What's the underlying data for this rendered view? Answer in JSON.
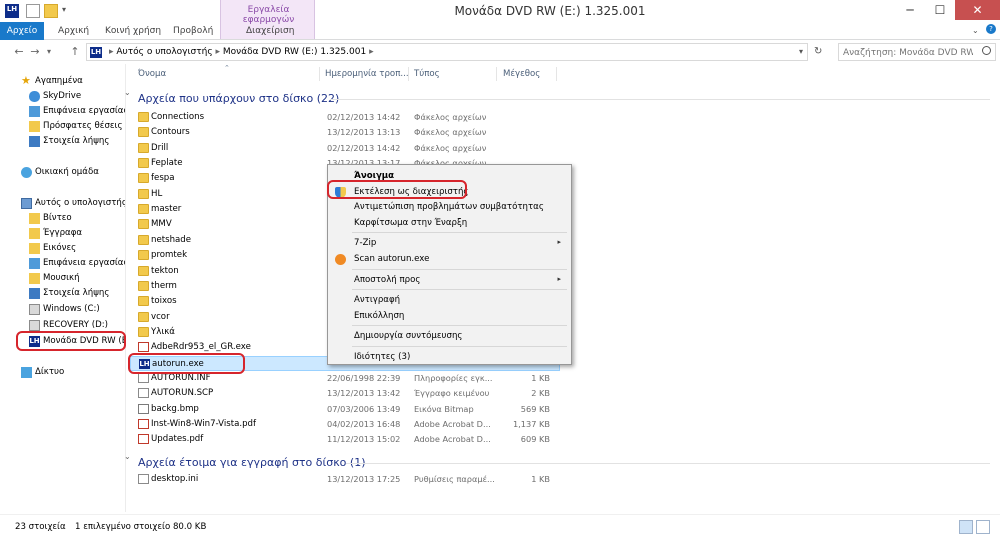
{
  "window": {
    "title": "Μονάδα DVD RW (E:) 1.325.001",
    "contextual_tab_group": "Εργαλεία εφαρμογών",
    "controls": {
      "minimize": "─",
      "maximize": "☐",
      "close": "✕"
    }
  },
  "ribbon": {
    "tabs": [
      "Αρχείο",
      "Αρχική",
      "Κοινή χρήση",
      "Προβολή",
      "Διαχείριση"
    ]
  },
  "address": {
    "back": "←",
    "forward": "→",
    "recent": "▾",
    "up": "↑",
    "crumbs": [
      "Αυτός ο υπολογιστής",
      "Μονάδα DVD RW (E:) 1.325.001"
    ],
    "search_placeholder": "Αναζήτηση: Μονάδα DVD RW...",
    "refresh": "↻",
    "search_icon": "search-icon"
  },
  "navpane": {
    "favorites": {
      "label": "Αγαπημένα",
      "items": [
        "SkyDrive",
        "Επιφάνεια εργασίας",
        "Πρόσφατες θέσεις",
        "Στοιχεία λήψης"
      ]
    },
    "homegroup": "Οικιακή ομάδα",
    "computer": {
      "label": "Αυτός ο υπολογιστής",
      "items": [
        "Βίντεο",
        "Έγγραφα",
        "Εικόνες",
        "Επιφάνεια εργασίας",
        "Μουσική",
        "Στοιχεία λήψης",
        "Windows (C:)",
        "RECOVERY (D:)",
        "Μονάδα DVD RW (E:"
      ]
    },
    "network": "Δίκτυο"
  },
  "columns": [
    "Όνομα",
    "Ημερομηνία τροπ...",
    "Τύπος",
    "Μέγεθος"
  ],
  "groups": [
    {
      "title": "Αρχεία που υπάρχουν στο δίσκο (22)"
    },
    {
      "title": "Αρχεία έτοιμα για εγγραφή στο δίσκο (1)"
    }
  ],
  "files": [
    {
      "name": "Connections",
      "date": "02/12/2013 14:42",
      "type": "Φάκελος αρχείων",
      "size": "",
      "icon": "folder"
    },
    {
      "name": "Contours",
      "date": "13/12/2013 13:13",
      "type": "Φάκελος αρχείων",
      "size": "",
      "icon": "folder"
    },
    {
      "name": "Drill",
      "date": "02/12/2013 14:42",
      "type": "Φάκελος αρχείων",
      "size": "",
      "icon": "folder"
    },
    {
      "name": "Feplate",
      "date": "13/12/2013 13:17",
      "type": "Φάκελος αρχείων",
      "size": "",
      "icon": "folder"
    },
    {
      "name": "fespa",
      "date": "",
      "type": "",
      "size": "",
      "icon": "folder"
    },
    {
      "name": "HL",
      "date": "",
      "type": "",
      "size": "",
      "icon": "folder"
    },
    {
      "name": "master",
      "date": "",
      "type": "",
      "size": "",
      "icon": "folder"
    },
    {
      "name": "MMV",
      "date": "",
      "type": "",
      "size": "",
      "icon": "folder"
    },
    {
      "name": "netshade",
      "date": "",
      "type": "",
      "size": "",
      "icon": "folder"
    },
    {
      "name": "promtek",
      "date": "",
      "type": "",
      "size": "",
      "icon": "folder"
    },
    {
      "name": "tekton",
      "date": "",
      "type": "",
      "size": "",
      "icon": "folder"
    },
    {
      "name": "therm",
      "date": "",
      "type": "",
      "size": "",
      "icon": "folder"
    },
    {
      "name": "toixos",
      "date": "",
      "type": "",
      "size": "",
      "icon": "folder"
    },
    {
      "name": "vcor",
      "date": "",
      "type": "",
      "size": "",
      "icon": "folder"
    },
    {
      "name": "Υλικά",
      "date": "",
      "type": "",
      "size": "",
      "icon": "folder"
    },
    {
      "name": "AdbeRdr953_el_GR.exe",
      "date": "",
      "type": "",
      "size": "",
      "icon": "exe"
    },
    {
      "name": "autorun.exe",
      "date": "",
      "type": "",
      "size": "",
      "icon": "lh"
    },
    {
      "name": "AUTORUN.INF",
      "date": "22/06/1998 22:39",
      "type": "Πληροφορίες εγκ...",
      "size": "1 KB",
      "icon": "file"
    },
    {
      "name": "AUTORUN.SCP",
      "date": "13/12/2013 13:42",
      "type": "Έγγραφο κειμένου",
      "size": "2 KB",
      "icon": "file"
    },
    {
      "name": "backg.bmp",
      "date": "07/03/2006 13:49",
      "type": "Εικόνα Bitmap",
      "size": "569 KB",
      "icon": "bmp"
    },
    {
      "name": "Inst-Win8-Win7-Vista.pdf",
      "date": "04/02/2013 16:48",
      "type": "Adobe Acrobat D...",
      "size": "1,137 KB",
      "icon": "pdf"
    },
    {
      "name": "Updates.pdf",
      "date": "11/12/2013 15:02",
      "type": "Adobe Acrobat D...",
      "size": "609 KB",
      "icon": "pdf"
    }
  ],
  "pending_files": [
    {
      "name": "desktop.ini",
      "date": "13/12/2013 17:25",
      "type": "Ρυθμίσεις παραμέ...",
      "size": "1 KB",
      "icon": "file"
    }
  ],
  "context_menu": {
    "items": [
      {
        "label": "Άνοιγμα",
        "bold": true,
        "arrow": ""
      },
      {
        "label": "Εκτέλεση ως διαχειριστής",
        "icon": "shield-icon",
        "arrow": ""
      },
      {
        "label": "Αντιμετώπιση προβλημάτων συμβατότητας",
        "arrow": ""
      },
      {
        "label": "Καρφίτσωμα στην Έναρξη",
        "arrow": ""
      },
      {
        "label": "7-Zip",
        "arrow": "▸"
      },
      {
        "label": "Scan autorun.exe",
        "icon": "avast-icon",
        "arrow": ""
      },
      {
        "label": "Αποστολή προς",
        "arrow": "▸"
      },
      {
        "label": "Αντιγραφή",
        "arrow": ""
      },
      {
        "label": "Επικόλληση",
        "arrow": ""
      },
      {
        "label": "Δημιουργία συντόμευσης",
        "arrow": ""
      },
      {
        "label": "Ιδιότητες (3)",
        "arrow": ""
      }
    ]
  },
  "status": {
    "count": "23 στοιχεία",
    "selection": "1 επιλεγμένο στοιχείο 80.0 KB"
  },
  "colors": {
    "accent": "#1979ca",
    "annotation": "#d6252c",
    "selection": "#cce8ff"
  }
}
